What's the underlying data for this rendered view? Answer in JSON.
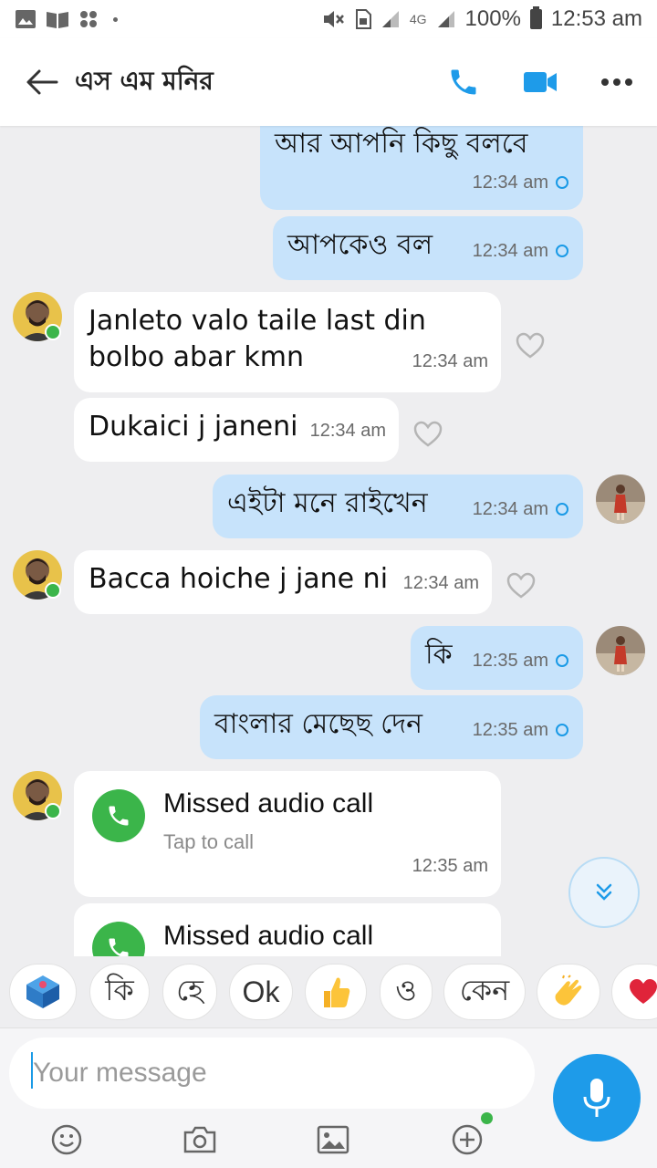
{
  "statusbar": {
    "battery": "100%",
    "time": "12:53 am",
    "network": "4G"
  },
  "header": {
    "title": "এস এম মনির"
  },
  "messages": [
    {
      "text": "আর আপনি কিছু বলবে",
      "time": "12:34 am"
    },
    {
      "text": "আপকেও বল",
      "time": "12:34 am"
    },
    {
      "text_line1": "Janleto valo taile last din",
      "text_line2": "bolbo abar kmn",
      "time": "12:34 am"
    },
    {
      "text": "Dukaici j janeni",
      "time": "12:34 am"
    },
    {
      "text": "এইটা মনে রাইখেন",
      "time": "12:34 am"
    },
    {
      "text": "Bacca hoiche j jane ni",
      "time": "12:34 am"
    },
    {
      "text": "কি",
      "time": "12:35 am"
    },
    {
      "text": "বাংলার মেছেছ দেন",
      "time": "12:35 am"
    }
  ],
  "calls": [
    {
      "title": "Missed audio call",
      "subtitle": "Tap to call",
      "time": "12:35 am"
    },
    {
      "title": "Missed audio call"
    }
  ],
  "quick_replies": [
    "কি",
    "হে",
    "Ok",
    "ও",
    "কেন"
  ],
  "composer": {
    "placeholder": "Your message"
  },
  "colors": {
    "accent": "#1e9be9",
    "outgoing_bubble": "#c7e3fb",
    "incoming_bubble": "#ffffff",
    "online": "#3bb54a",
    "call_green": "#3bb54a"
  }
}
